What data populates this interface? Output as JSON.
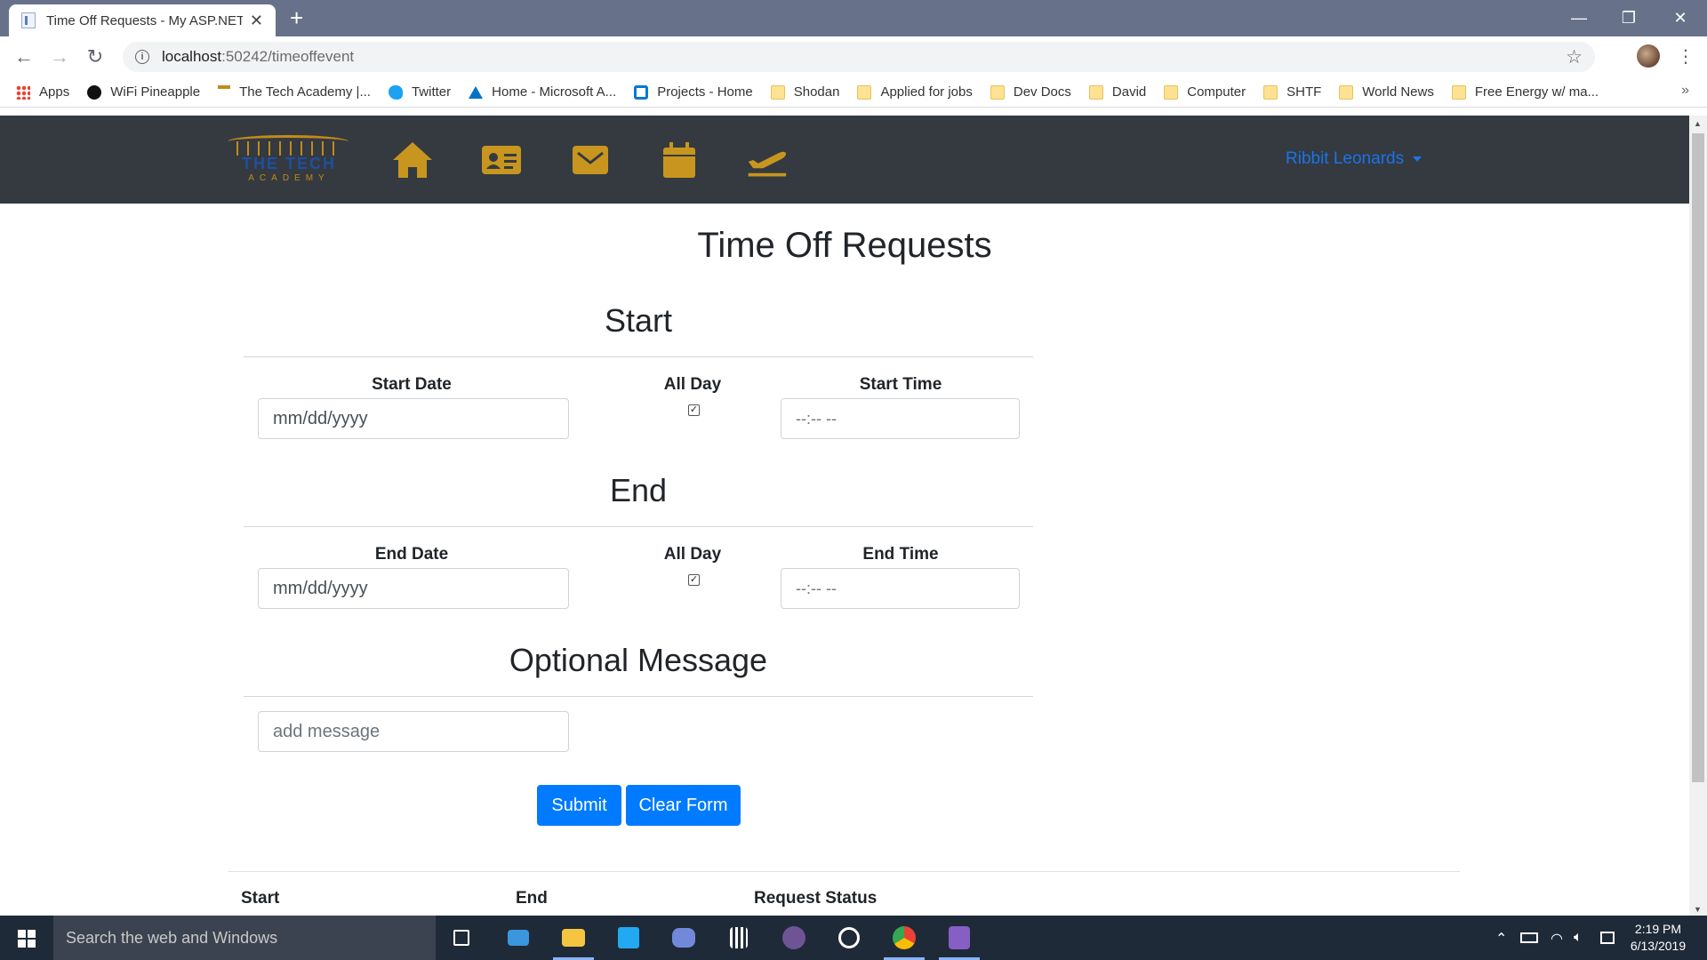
{
  "browser": {
    "tab_title": "Time Off Requests - My ASP.NET",
    "url_host": "localhost",
    "url_rest": ":50242/timeoffevent",
    "bookmarks": [
      "Apps",
      "WiFi Pineapple",
      "The Tech Academy |...",
      "Twitter",
      "Home - Microsoft A...",
      "Projects - Home",
      "Shodan",
      "Applied for jobs",
      "Dev Docs",
      "David",
      "Computer",
      "SHTF",
      "World News",
      "Free Energy w/ ma..."
    ]
  },
  "site": {
    "logo_top": "THE TECH",
    "logo_bottom": "ACADEMY",
    "nav_icons": [
      "home-icon",
      "id-card-icon",
      "envelope-icon",
      "calendar-icon",
      "plane-departure-icon"
    ],
    "user_name": "Ribbit Leonards",
    "accent_color": "#c8961e",
    "link_color": "#1a73e8"
  },
  "page": {
    "title": "Time Off Requests",
    "start": {
      "heading": "Start",
      "date_label": "Start Date",
      "date_value": "mm/dd/yyyy",
      "allday_label": "All Day",
      "allday_checked": true,
      "time_label": "Start Time",
      "time_value": "--:-- --"
    },
    "end": {
      "heading": "End",
      "date_label": "End Date",
      "date_value": "mm/dd/yyyy",
      "allday_label": "All Day",
      "allday_checked": true,
      "time_label": "End Time",
      "time_value": "--:-- --"
    },
    "message": {
      "heading": "Optional Message",
      "placeholder": "add message"
    },
    "buttons": {
      "submit": "Submit",
      "clear": "Clear Form"
    },
    "table_headers": [
      "Start",
      "End",
      "Request Status"
    ],
    "button_color": "#007bff"
  },
  "taskbar": {
    "search_placeholder": "Search the web and Windows",
    "time": "2:19 PM",
    "date": "6/13/2019"
  }
}
